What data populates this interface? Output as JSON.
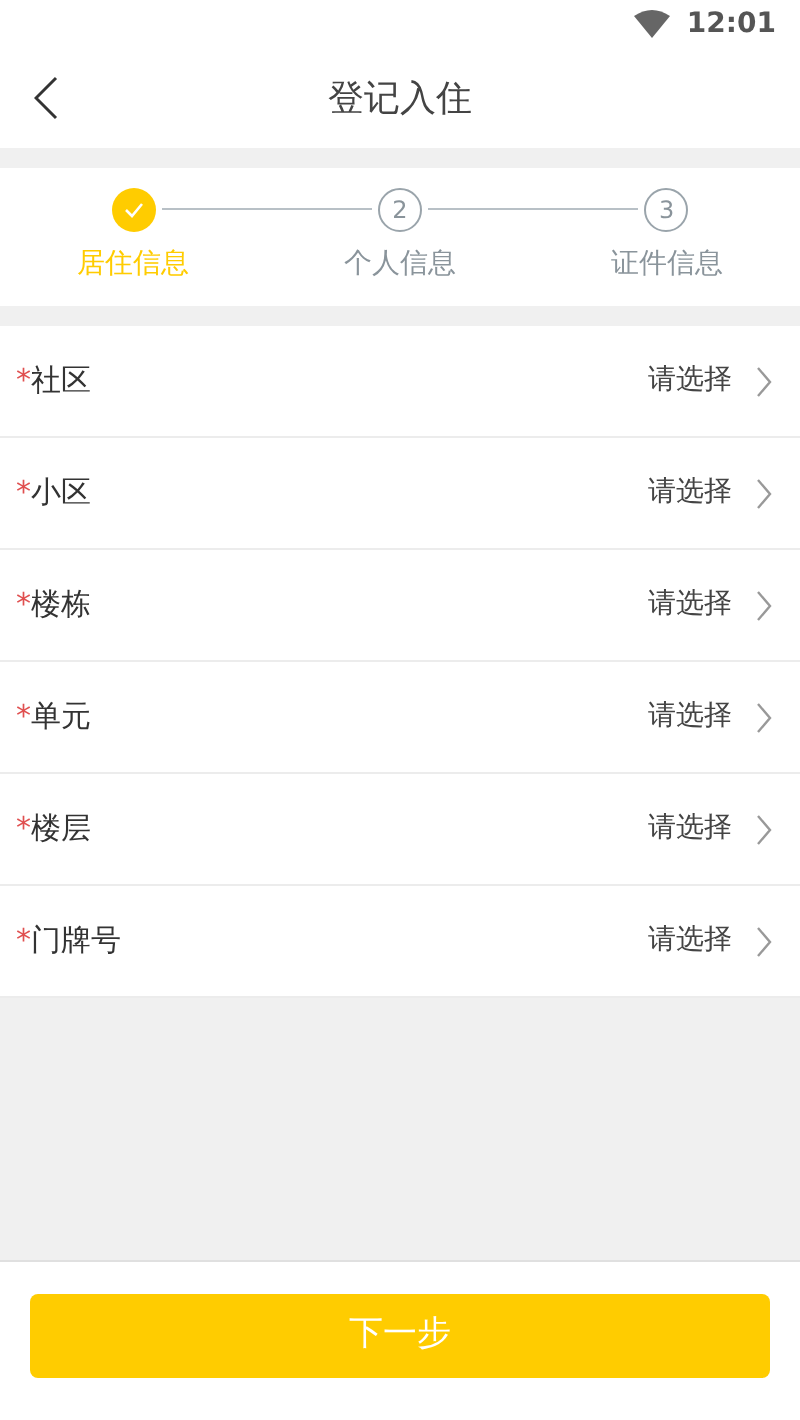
{
  "status_bar": {
    "time": "12:01"
  },
  "header": {
    "title": "登记入住"
  },
  "steps": [
    {
      "label": "居住信息",
      "completed": true
    },
    {
      "number": "2",
      "label": "个人信息",
      "completed": false
    },
    {
      "number": "3",
      "label": "证件信息",
      "completed": false
    }
  ],
  "fields": [
    {
      "required_mark": "*",
      "label": "社区",
      "value": "请选择"
    },
    {
      "required_mark": "*",
      "label": "小区",
      "value": "请选择"
    },
    {
      "required_mark": "*",
      "label": "楼栋",
      "value": "请选择"
    },
    {
      "required_mark": "*",
      "label": "单元",
      "value": "请选择"
    },
    {
      "required_mark": "*",
      "label": "楼层",
      "value": "请选择"
    },
    {
      "required_mark": "*",
      "label": "门牌号",
      "value": "请选择"
    }
  ],
  "next_button": "下一步"
}
